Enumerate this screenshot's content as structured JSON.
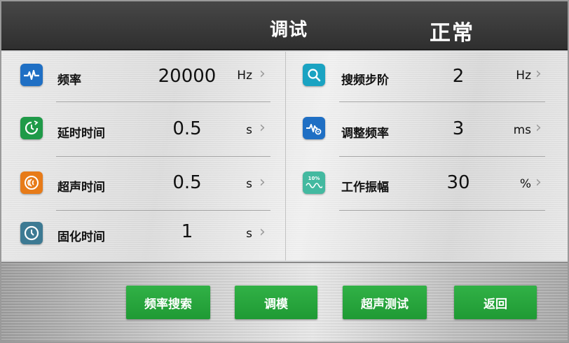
{
  "header": {
    "title": "调试",
    "status": "正常"
  },
  "left_items": [
    {
      "label": "频率",
      "value": "20000",
      "unit": "Hz",
      "icon": "pulse-icon",
      "color": "#1f6fc4"
    },
    {
      "label": "延时时间",
      "value": "0.5",
      "unit": "s",
      "icon": "clock-arrow-icon",
      "color": "#1f9a48"
    },
    {
      "label": "超声时间",
      "value": "0.5",
      "unit": "s",
      "icon": "ultrasonic-icon",
      "color": "#e77b19"
    },
    {
      "label": "固化时间",
      "value": "1",
      "unit": "s",
      "icon": "clock-icon",
      "color": "#3d7a93"
    }
  ],
  "right_items": [
    {
      "label": "搜频步阶",
      "value": "2",
      "unit": "Hz",
      "icon": "search-icon",
      "color": "#1aa3c2"
    },
    {
      "label": "调整频率",
      "value": "3",
      "unit": "ms",
      "icon": "pulse-gear-icon",
      "color": "#1f6fc4"
    },
    {
      "label": "工作振幅",
      "value": "30",
      "unit": "%",
      "icon": "amplitude-icon",
      "color": "#43b9a0",
      "icon_text": "10%"
    }
  ],
  "chevron": "›",
  "buttons": [
    "频率搜索",
    "调模",
    "超声测试",
    "返回"
  ]
}
